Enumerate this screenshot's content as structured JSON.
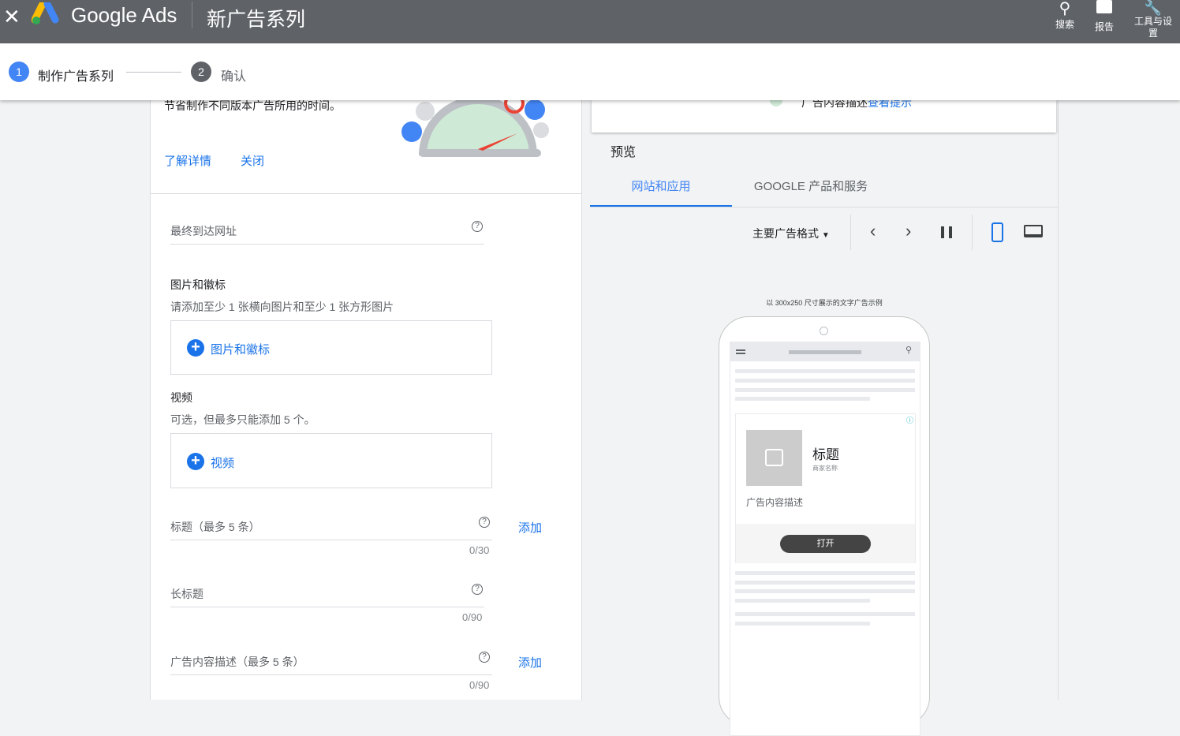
{
  "header": {
    "close_icon": "close-icon",
    "product": "Google Ads",
    "title": "新广告系列",
    "actions": [
      {
        "label": "搜索",
        "icon": "search-icon"
      },
      {
        "label": "报告",
        "icon": "bar-chart-icon"
      },
      {
        "label": "工具与设置",
        "icon": "wrench-icon"
      }
    ]
  },
  "stepper": {
    "steps": [
      {
        "num": "1",
        "label": "制作广告系列",
        "active": true
      },
      {
        "num": "2",
        "label": "确认",
        "active": false
      }
    ]
  },
  "banner": {
    "text": "节省制作不同版本广告所用的时间。",
    "learn_more": "了解详情",
    "close": "关闭"
  },
  "form": {
    "final_url": {
      "label": "最终到达网址",
      "help": "?"
    },
    "images": {
      "heading": "图片和徽标",
      "hint": "请添加至少 1 张横向图片和至少 1 张方形图片",
      "button": "图片和徽标"
    },
    "videos": {
      "heading": "视频",
      "hint": "可选，但最多只能添加 5 个。",
      "button": "视频"
    },
    "headline": {
      "label": "标题（最多 5 条）",
      "counter": "0/30",
      "add": "添加"
    },
    "long_headline": {
      "label": "长标题",
      "counter": "0/90"
    },
    "description": {
      "label": "广告内容描述（最多 5 条）",
      "counter": "0/90",
      "add": "添加"
    }
  },
  "tips": {
    "item": "广告内容描述",
    "link": "查看提示"
  },
  "preview": {
    "title": "预览",
    "tabs": [
      {
        "label": "网站和应用",
        "active": true
      },
      {
        "label": "GOOGLE 产品和服务",
        "active": false
      }
    ],
    "format_select": "主要广告格式",
    "caption": "以 300x250 尺寸展示的文字广告示例",
    "ad": {
      "headline": "标题",
      "business": "商家名称",
      "description": "广告内容描述",
      "cta": "打开"
    }
  },
  "colors": {
    "accent": "#1a73e8",
    "topbar": "#5f6368"
  }
}
